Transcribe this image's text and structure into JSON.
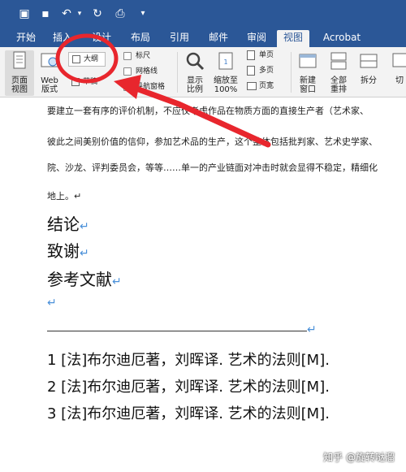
{
  "tabs": [
    "开始",
    "插入",
    "设计",
    "布局",
    "引用",
    "邮件",
    "审阅",
    "视图",
    "Acrobat"
  ],
  "active_tab_index": 7,
  "ribbon": {
    "page_view": "页面\n视图",
    "web_layout": "Web\n版式",
    "outline": "大纲",
    "draft": "草稿",
    "ruler": "标尺",
    "gridlines": "网格线",
    "nav_pane": "导航窗格",
    "show_ratio": "显示\n比例",
    "zoom_100": "缩放至\n100%",
    "one_page": "单页",
    "multi_page": "多页",
    "page_width": "页宽",
    "new_window": "新建\n窗口",
    "arrange_all": "全部\n重排",
    "split": "拆分",
    "switch": "切"
  },
  "doc": {
    "line1": "要建立一套有序的评价机制，不应仅考虑作品在物质方面的直接生产者（艺术家、",
    "line2": "彼此之间美别价值的信仰，参加艺术品的生产，这个整体包括批判家、艺术史学家、",
    "line3": "院、沙龙、评判委员会，等等……单一的产业链面对冲击时就会显得不稳定，精细化",
    "line4": "地上。↵",
    "h1": "结论",
    "h2": "致谢",
    "h3": "参考文献",
    "refs": [
      "1 [法]布尔迪厄著，刘晖译. 艺术的法则[M].",
      "2 [法]布尔迪厄著，刘晖译. 艺术的法则[M].",
      "3 [法]布尔迪厄著，刘晖译. 艺术的法则[M]."
    ]
  },
  "para_mark": "↵",
  "watermark": "知乎 @旋转哒溜",
  "colors": {
    "titlebar": "#2b5797",
    "annotation": "#e8262d",
    "para_mark": "#4a90d9"
  }
}
